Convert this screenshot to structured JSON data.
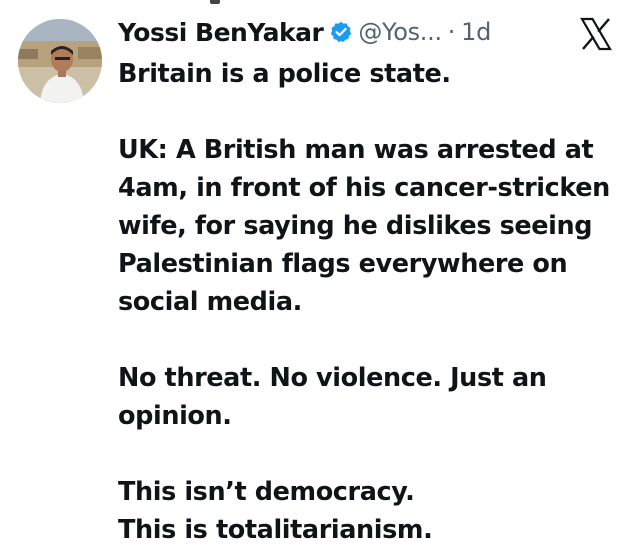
{
  "tweet": {
    "author": {
      "display_name": "Yossi BenYakar",
      "handle": "@Yos...",
      "verified": true,
      "avatar_icon": "profile-photo"
    },
    "separator": "·",
    "timestamp": "1d",
    "platform_icon": "x-logo-icon",
    "paragraphs": [
      "Britain is a police state.",
      "UK: A British man was arrested at\n4am, in front of his cancer-stricken\nwife, for saying he dislikes seeing\nPalestinian flags everywhere on\nsocial media.",
      "No threat. No violence. Just an\nopinion.",
      "This isn’t democracy.\nThis is totalitarianism."
    ]
  },
  "colors": {
    "text": "#0f1419",
    "secondary": "#536471",
    "verified_blue": "#1d9bf0"
  }
}
